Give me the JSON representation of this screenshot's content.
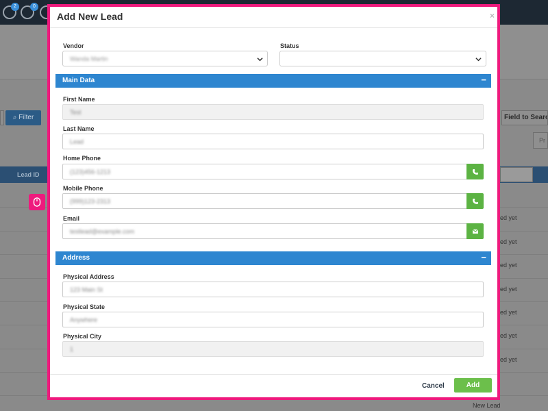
{
  "background": {
    "badges": [
      "2",
      "0"
    ],
    "filter_label": "Filter",
    "field_search_label": "Field to Search",
    "pr_label": "Pr",
    "lead_id_header": "Lead ID",
    "row_status_text": "ed yet",
    "new_lead_text": "New Lead"
  },
  "modal": {
    "title": "Add New Lead",
    "close_glyph": "×",
    "vendor_label": "Vendor",
    "vendor_value": "Wanda Martin",
    "status_label": "Status",
    "status_value": "",
    "sections": {
      "main_data": "Main Data",
      "address": "Address",
      "toggle_glyph": "−"
    },
    "fields": {
      "first_name_label": "First Name",
      "first_name_value": "Test",
      "last_name_label": "Last Name",
      "last_name_value": "Lead",
      "home_phone_label": "Home Phone",
      "home_phone_value": "(123)456-1213",
      "mobile_phone_label": "Mobile Phone",
      "mobile_phone_value": "(999)123-2313",
      "email_label": "Email",
      "email_value": "testlead@example.com",
      "physical_address_label": "Physical Address",
      "physical_address_value": "123 Main St",
      "physical_state_label": "Physical State",
      "physical_state_value": "Anywhere",
      "physical_city_label": "Physical City",
      "physical_city_value": "1"
    },
    "footer": {
      "cancel_label": "Cancel",
      "add_label": "Add"
    }
  },
  "colors": {
    "highlight": "#ee1a7d",
    "section_bar": "#2e86d0",
    "addon_green": "#5cb343",
    "add_button": "#6cbf4b"
  },
  "icons": [
    "phone-icon",
    "envelope-icon",
    "chevron-down-icon",
    "mouse-icon"
  ]
}
